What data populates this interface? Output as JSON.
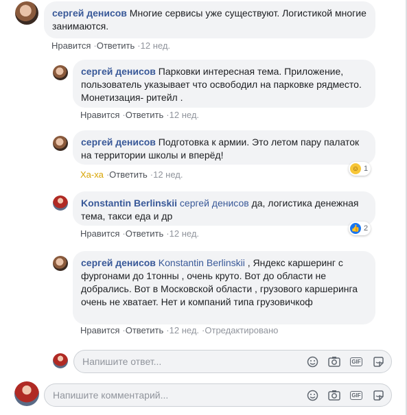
{
  "comments": [
    {
      "author": "сергей денисов",
      "mention": "",
      "text": " Многие сервисы уже существуют. Логистикой многие занимаются.",
      "like": "Нравится",
      "reply": "Ответить",
      "time": "12 нед.",
      "extra": ""
    },
    {
      "author": "сергей денисов",
      "mention": "",
      "text": " Парковки интересная тема. Приложение, пользователь указывает что освободил на парковке рядместо. Монетизация- ритейл .",
      "like": "Нравится",
      "reply": "Ответить",
      "time": "12 нед.",
      "extra": ""
    },
    {
      "author": "сергей денисов",
      "mention": "",
      "text": " Подготовка к армии. Это летом пару палаток на территории школы и вперёд!",
      "like": "Ха-ха",
      "reply": "Ответить",
      "time": "12 нед.",
      "extra": "",
      "reaction_count": "1"
    },
    {
      "author": "Konstantin Berlinskii",
      "mention": " сергей денисов",
      "text": " да, логистика денежная тема, такси еда и др",
      "like": "Нравится",
      "reply": "Ответить",
      "time": "12 нед.",
      "extra": "",
      "reaction_count": "2"
    },
    {
      "author": "сергей денисов",
      "mention": " Konstantin Berlinskii",
      "text": " , Яндекс каршеринг с фургонами до 1тонны , очень круто. Вот до области не добрались. Вот в Московской области , грузового каршеринга очень не хватает. Нет и компаний типа грузовичкоф",
      "like": "Нравится",
      "reply": "Ответить",
      "time": "12 нед.",
      "extra": "Отредактировано"
    }
  ],
  "reply_input": {
    "placeholder": "Напишите ответ..."
  },
  "comment_input": {
    "placeholder": "Напишите комментарий..."
  },
  "composer_icons": [
    "smiley-icon",
    "camera-icon",
    "gif-icon",
    "sticker-icon"
  ],
  "colors": {
    "link": "#385898",
    "bubble": "#f2f3f5",
    "meta": "#4b4f56",
    "haha": "#d7a300",
    "like": "#1877f2"
  }
}
